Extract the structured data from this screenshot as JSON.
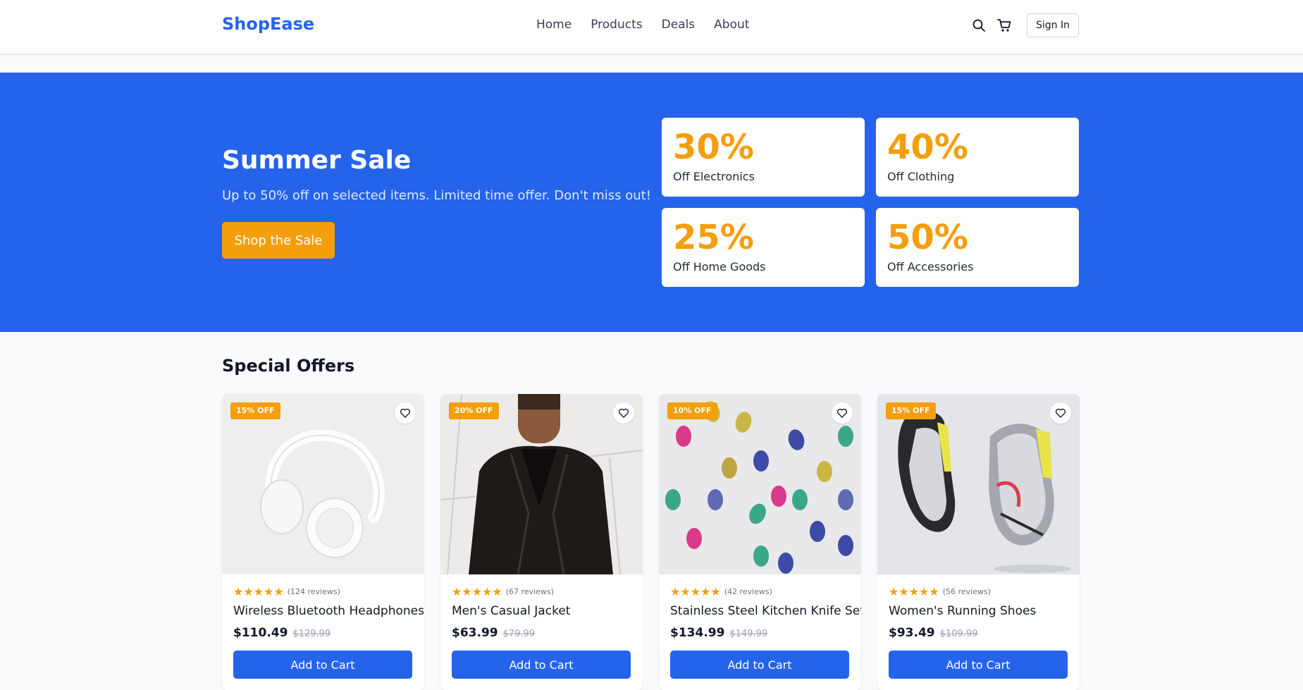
{
  "header": {
    "logo": "ShopEase",
    "nav": [
      "Home",
      "Products",
      "Deals",
      "About"
    ],
    "search_icon": "search-icon",
    "cart_icon": "cart-icon",
    "sign_in": "Sign In"
  },
  "hero": {
    "title": "Summer Sale",
    "subtitle": "Up to 50% off on selected items. Limited time offer. Don't miss out!",
    "cta": "Shop the Sale",
    "deals": [
      {
        "percent": "30%",
        "label": "Off Electronics"
      },
      {
        "percent": "40%",
        "label": "Off Clothing"
      },
      {
        "percent": "25%",
        "label": "Off Home Goods"
      },
      {
        "percent": "50%",
        "label": "Off Accessories"
      }
    ]
  },
  "offers": {
    "title": "Special Offers",
    "products": [
      {
        "badge": "15% OFF",
        "rating": 5,
        "reviews": "(124 reviews)",
        "name": "Wireless Bluetooth Headphones",
        "price": "$110.49",
        "old_price": "$129.99",
        "button": "Add to Cart"
      },
      {
        "badge": "20% OFF",
        "rating": 5,
        "reviews": "(67 reviews)",
        "name": "Men's Casual Jacket",
        "price": "$63.99",
        "old_price": "$79.99",
        "button": "Add to Cart"
      },
      {
        "badge": "10% OFF",
        "rating": 5,
        "reviews": "(42 reviews)",
        "name": "Stainless Steel Kitchen Knife Set",
        "price": "$134.99",
        "old_price": "$149.99",
        "button": "Add to Cart"
      },
      {
        "badge": "15% OFF",
        "rating": 5,
        "reviews": "(56 reviews)",
        "name": "Women's Running Shoes",
        "price": "$93.49",
        "old_price": "$109.99",
        "button": "Add to Cart"
      }
    ]
  },
  "colors": {
    "primary": "#2563eb",
    "accent": "#f59e0b"
  }
}
